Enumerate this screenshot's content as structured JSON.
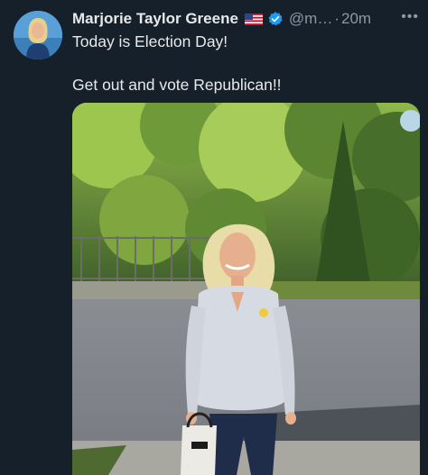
{
  "tweet": {
    "author_name": "Marjorie Taylor Greene",
    "handle": "@m…",
    "separator": "·",
    "timestamp": "20m",
    "more_label": "•••",
    "lines": [
      "Today is Election Day!",
      "Get out and vote Republican!!"
    ]
  },
  "icons": {
    "flag": "us-flag-icon",
    "verified": "verified-badge-icon",
    "more": "more-options-icon"
  },
  "colors": {
    "background": "#15202b",
    "text": "#e7e9ea",
    "muted": "#8b98a5",
    "verified": "#1d9bf0"
  }
}
